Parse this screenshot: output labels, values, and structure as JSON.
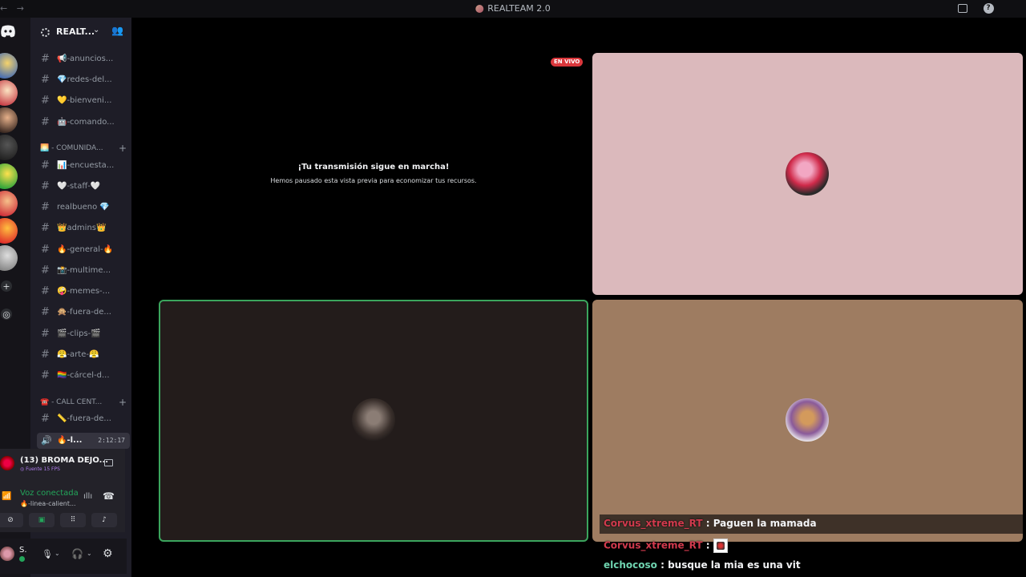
{
  "titlebar": {
    "title": "REALTEAM 2.0",
    "nav": "← →"
  },
  "guild": {
    "name": "REALT...",
    "chevron": "⌄",
    "invite_icon": "👥"
  },
  "channels": [
    {
      "label": "📢-anuncios..."
    },
    {
      "label": "💎redes-del..."
    },
    {
      "label": "💛-bienveni..."
    },
    {
      "label": "🤖-comando..."
    },
    {
      "label": "📊-encuesta..."
    },
    {
      "label": "🤍-staff-🤍"
    },
    {
      "label": "realbueno 💎"
    },
    {
      "label": "👑admins👑"
    },
    {
      "label": "🔥-general-🔥"
    },
    {
      "label": "📸-multime..."
    },
    {
      "label": "🤪-memes-..."
    },
    {
      "label": "🙊-fuera-de..."
    },
    {
      "label": "🎬-clips-🎬"
    },
    {
      "label": "😤-arte-😤"
    },
    {
      "label": "🏳️‍🌈-cárcel-d..."
    },
    {
      "label": "📏-fuera-de..."
    }
  ],
  "categories": [
    {
      "label": "🌅 - COMUNIDA..."
    },
    {
      "label": "☎️ - CALL CENT..."
    }
  ],
  "voice_channel": {
    "label": "🔥-l...",
    "time": "2:12:17"
  },
  "stream_panel": {
    "name": "(13) BROMA DEJO...",
    "fps": "◎ Fuente 15 FPS"
  },
  "voice_panel": {
    "status": "Voz conectada",
    "channel": "🔥-linea-calient..."
  },
  "user_panel": {
    "name": "S."
  },
  "stage": {
    "live_badge": "EN VIVO",
    "paused_title": "¡Tu transmisión sigue en marcha!",
    "paused_subtitle": "Hemos pausado esta vista previa para economizar tus recursos.",
    "tile_colors": {
      "top_right": "#dbb9bc",
      "bottom_left": "#231c1b",
      "bottom_right": "#9e7c61",
      "speaking_border": "#3ba55d"
    }
  },
  "chat": [
    {
      "user": "Corvus_xtreme_RT",
      "user_color": "#d13a4d",
      "sep": " : ",
      "text": "Paguen la mamada"
    },
    {
      "user": "Corvus_xtreme_RT",
      "user_color": "#d13a4d",
      "sep": " : ",
      "text": ""
    },
    {
      "user": "elchocoso",
      "user_color": "#6fd4b0",
      "sep": " : ",
      "text": "busque la mia es una vit"
    }
  ]
}
